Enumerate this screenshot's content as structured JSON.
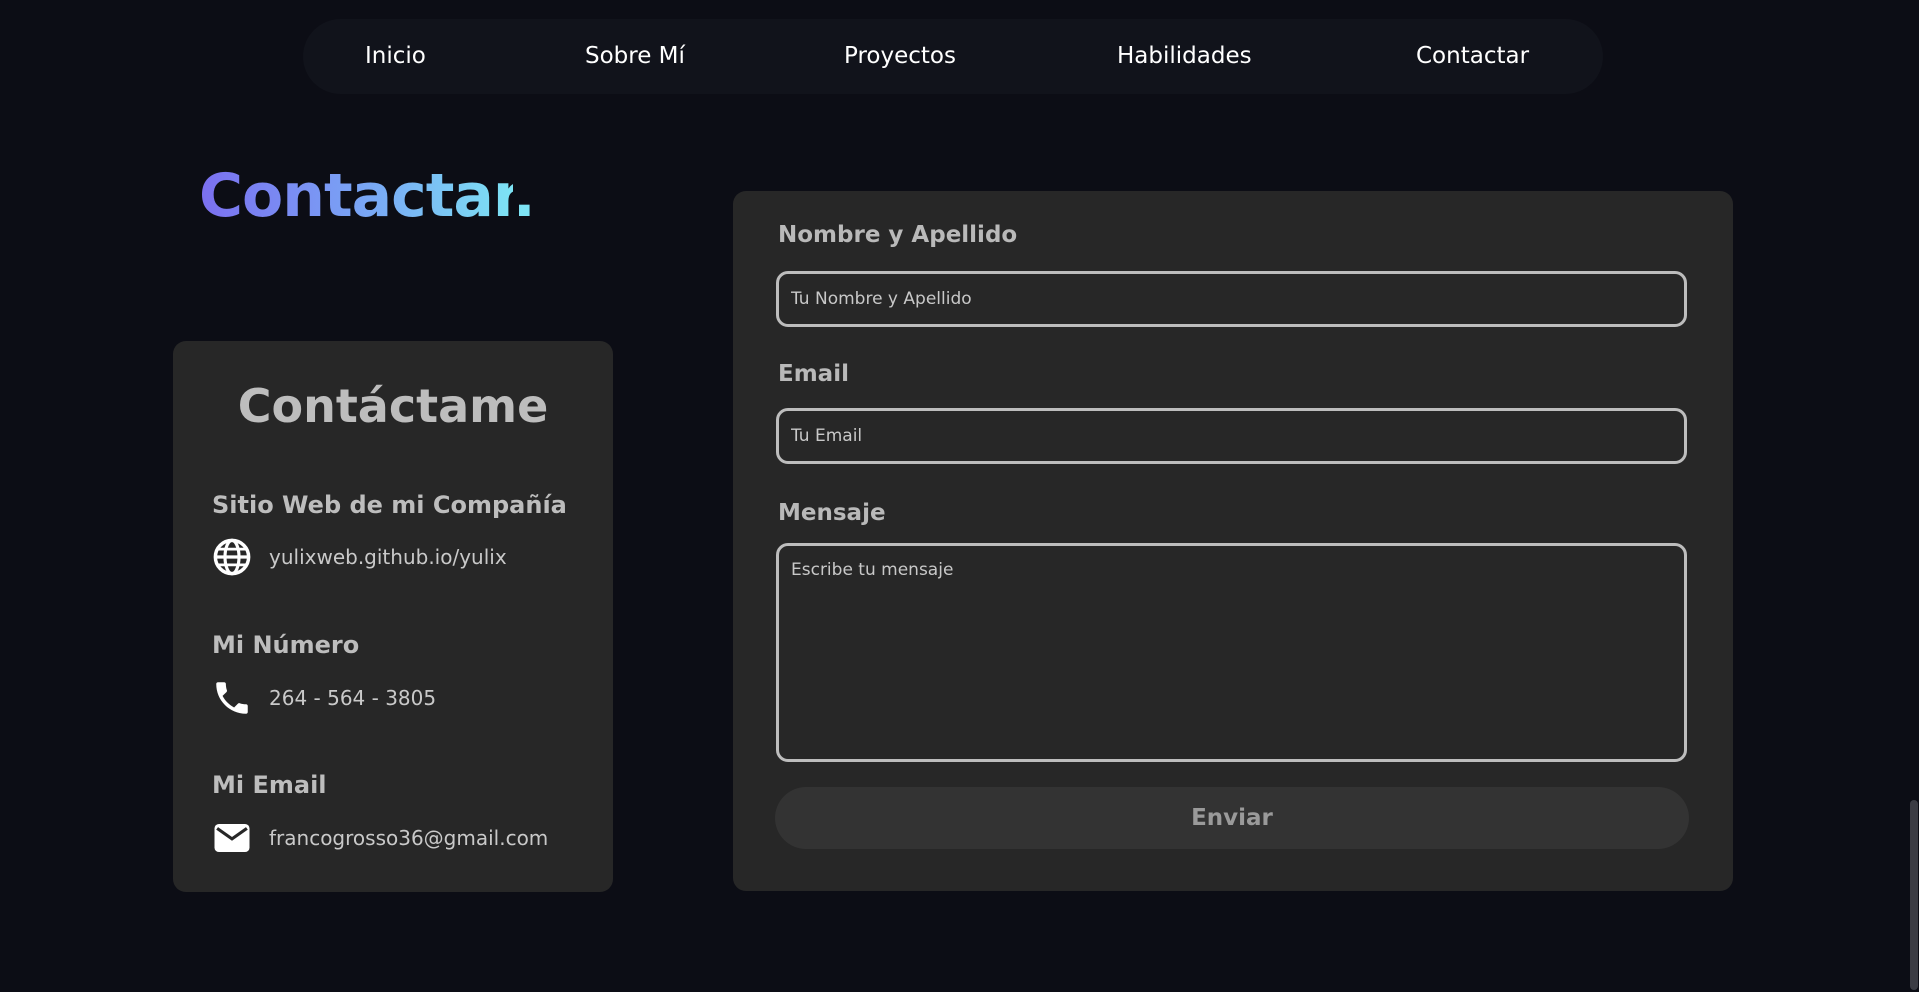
{
  "nav": {
    "items": [
      {
        "label": "Inicio"
      },
      {
        "label": "Sobre Mí"
      },
      {
        "label": "Proyectos"
      },
      {
        "label": "Habilidades"
      },
      {
        "label": "Contactar"
      }
    ]
  },
  "section": {
    "title": "Contactar",
    "title_dot": "."
  },
  "info_card": {
    "heading": "Contáctame",
    "website": {
      "label": "Sitio Web de mi Compañía",
      "value": "yulixweb.github.io/yulix",
      "icon": "globe-icon"
    },
    "phone": {
      "label": "Mi Número",
      "value": "264 - 564 - 3805",
      "icon": "phone-icon"
    },
    "email": {
      "label": "Mi Email",
      "value": "francogrosso36@gmail.com",
      "icon": "mail-icon"
    }
  },
  "form": {
    "name_label": "Nombre y Apellido",
    "name_placeholder": "Tu Nombre y Apellido",
    "email_label": "Email",
    "email_placeholder": "Tu Email",
    "message_label": "Mensaje",
    "message_placeholder": "Escribe tu mensaje",
    "submit_label": "Enviar"
  },
  "colors": {
    "background": "#0c0d15",
    "nav_background": "#11131b",
    "card_background": "#272727",
    "gradient_start": "#7b6ff0",
    "gradient_end": "#7de3f4",
    "muted_text": "#bdbdbd"
  }
}
